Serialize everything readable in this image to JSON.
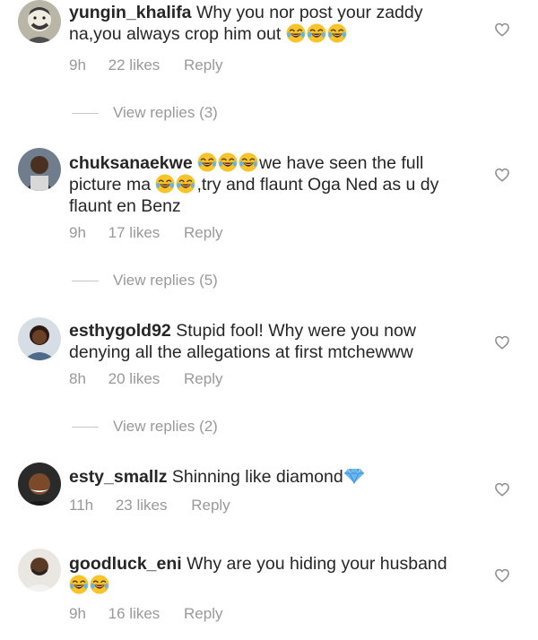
{
  "comments": [
    {
      "username": "yungin_khalifa",
      "text": " Why you nor post your zaddy na,you always crop him out ",
      "emoji_after": "😂😂😂",
      "time": "9h",
      "likes": "22 likes",
      "reply": "Reply",
      "view_replies": "View replies (3)"
    },
    {
      "username": "chuksanaekwe",
      "emoji_lead": "😂😂😂",
      "text_1": "we have seen the full picture ma ",
      "emoji_mid": "😂😂",
      "text_2": ",try and flaunt Oga Ned as u dy flaunt en Benz",
      "time": "9h",
      "likes": "17 likes",
      "reply": "Reply",
      "view_replies": "View replies (5)"
    },
    {
      "username": "esthygold92",
      "text": " Stupid fool! Why were you now denying all the allegations at first mtchewww",
      "time": "8h",
      "likes": "20 likes",
      "reply": "Reply",
      "view_replies": "View replies (2)"
    },
    {
      "username": "esty_smallz",
      "text": " Shinning like diamond",
      "emoji_after": "💎",
      "time": "11h",
      "likes": "23 likes",
      "reply": "Reply"
    },
    {
      "username": "goodluck_eni",
      "text": " Why are you hiding your husband ",
      "emoji_after": "😂😂",
      "time": "9h",
      "likes": "16 likes",
      "reply": "Reply"
    }
  ],
  "icons": {
    "like": "heart-outline-icon",
    "emoji": "face-with-tears-of-joy",
    "diamond": "gem-stone"
  },
  "colors": {
    "text": "#262626",
    "meta": "#999999",
    "heart": "#8e8e8e",
    "divider": "#c7c7c7"
  }
}
